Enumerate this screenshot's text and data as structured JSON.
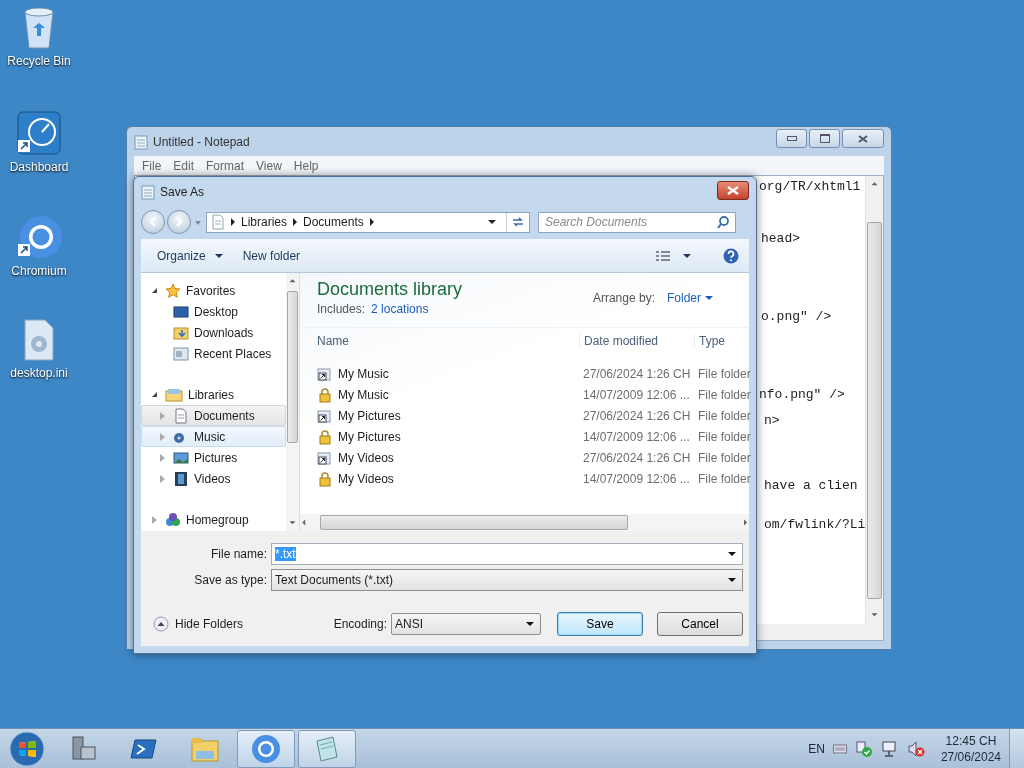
{
  "desktop_icons": [
    {
      "label": "Recycle Bin",
      "kind": "recycle"
    },
    {
      "label": "Dashboard",
      "kind": "dashboard"
    },
    {
      "label": "Chromium",
      "kind": "chromium"
    },
    {
      "label": "desktop.ini",
      "kind": "ini"
    }
  ],
  "notepad": {
    "title": "Untitled - Notepad",
    "menu": [
      "File",
      "Edit",
      "Format",
      "View",
      "Help"
    ],
    "text_lines": [
      "org/TR/xhtml1",
      "head>",
      "o.png\" />",
      "nfo.png\" />",
      "n>",
      "have a clien",
      "om/fwlink/?Li"
    ]
  },
  "save_dialog": {
    "title": "Save As",
    "breadcrumb": [
      "Libraries",
      "Documents"
    ],
    "search": {
      "placeholder": "Search Documents"
    },
    "toolbar": {
      "organize": "Organize",
      "new_folder": "New folder"
    },
    "nav_tree": [
      {
        "label": "Favorites",
        "kind": "favorites",
        "expanded": true,
        "selected": false,
        "hovered": false,
        "children": [
          {
            "label": "Desktop",
            "kind": "desktop",
            "selected": false,
            "hovered": false
          },
          {
            "label": "Downloads",
            "kind": "downloads",
            "selected": false,
            "hovered": false
          },
          {
            "label": "Recent Places",
            "kind": "recent",
            "selected": false,
            "hovered": false
          }
        ]
      },
      {
        "label": "Libraries",
        "kind": "libraries",
        "expanded": true,
        "selected": false,
        "hovered": false,
        "children": [
          {
            "label": "Documents",
            "kind": "documents",
            "expanded": false,
            "selected": true,
            "hovered": false
          },
          {
            "label": "Music",
            "kind": "music",
            "expanded": false,
            "selected": false,
            "hovered": true
          },
          {
            "label": "Pictures",
            "kind": "pictures",
            "expanded": false,
            "selected": false,
            "hovered": false
          },
          {
            "label": "Videos",
            "kind": "videos",
            "expanded": false,
            "selected": false,
            "hovered": false
          }
        ]
      },
      {
        "label": "Homegroup",
        "kind": "homegroup",
        "expanded": false,
        "selected": false,
        "hovered": false
      }
    ],
    "library": {
      "title": "Documents library",
      "includes_label": "Includes:",
      "includes_link": "2 locations",
      "arrange_label": "Arrange by:",
      "arrange_value": "Folder"
    },
    "columns": [
      "Name",
      "Date modified",
      "Type"
    ],
    "rows": [
      {
        "name": "My Music",
        "date": "27/06/2024 1:26 CH",
        "type": "File folder",
        "kind": "shortcut"
      },
      {
        "name": "My Music",
        "date": "14/07/2009 12:06 ...",
        "type": "File folder",
        "kind": "locked"
      },
      {
        "name": "My Pictures",
        "date": "27/06/2024 1:26 CH",
        "type": "File folder",
        "kind": "shortcut"
      },
      {
        "name": "My Pictures",
        "date": "14/07/2009 12:06 ...",
        "type": "File folder",
        "kind": "locked"
      },
      {
        "name": "My Videos",
        "date": "27/06/2024 1:26 CH",
        "type": "File folder",
        "kind": "shortcut"
      },
      {
        "name": "My Videos",
        "date": "14/07/2009 12:06 ...",
        "type": "File folder",
        "kind": "locked"
      }
    ],
    "file_name": {
      "label": "File name:",
      "value": "*.txt"
    },
    "save_type": {
      "label": "Save as type:",
      "value": "Text Documents (*.txt)"
    },
    "hide_folders": "Hide Folders",
    "encoding": {
      "label": "Encoding:",
      "value": "ANSI"
    },
    "buttons": [
      {
        "label": "Save",
        "kind": "default"
      },
      {
        "label": "Cancel",
        "kind": "normal"
      }
    ]
  },
  "taskbar": {
    "items": [
      {
        "kind": "server",
        "active": false
      },
      {
        "kind": "powershell",
        "active": false
      },
      {
        "kind": "explorer",
        "active": false
      },
      {
        "kind": "chromium",
        "active": true
      },
      {
        "kind": "notepad",
        "active": true
      }
    ],
    "language": "EN",
    "time": "12:45 CH",
    "date": "27/06/2024"
  }
}
